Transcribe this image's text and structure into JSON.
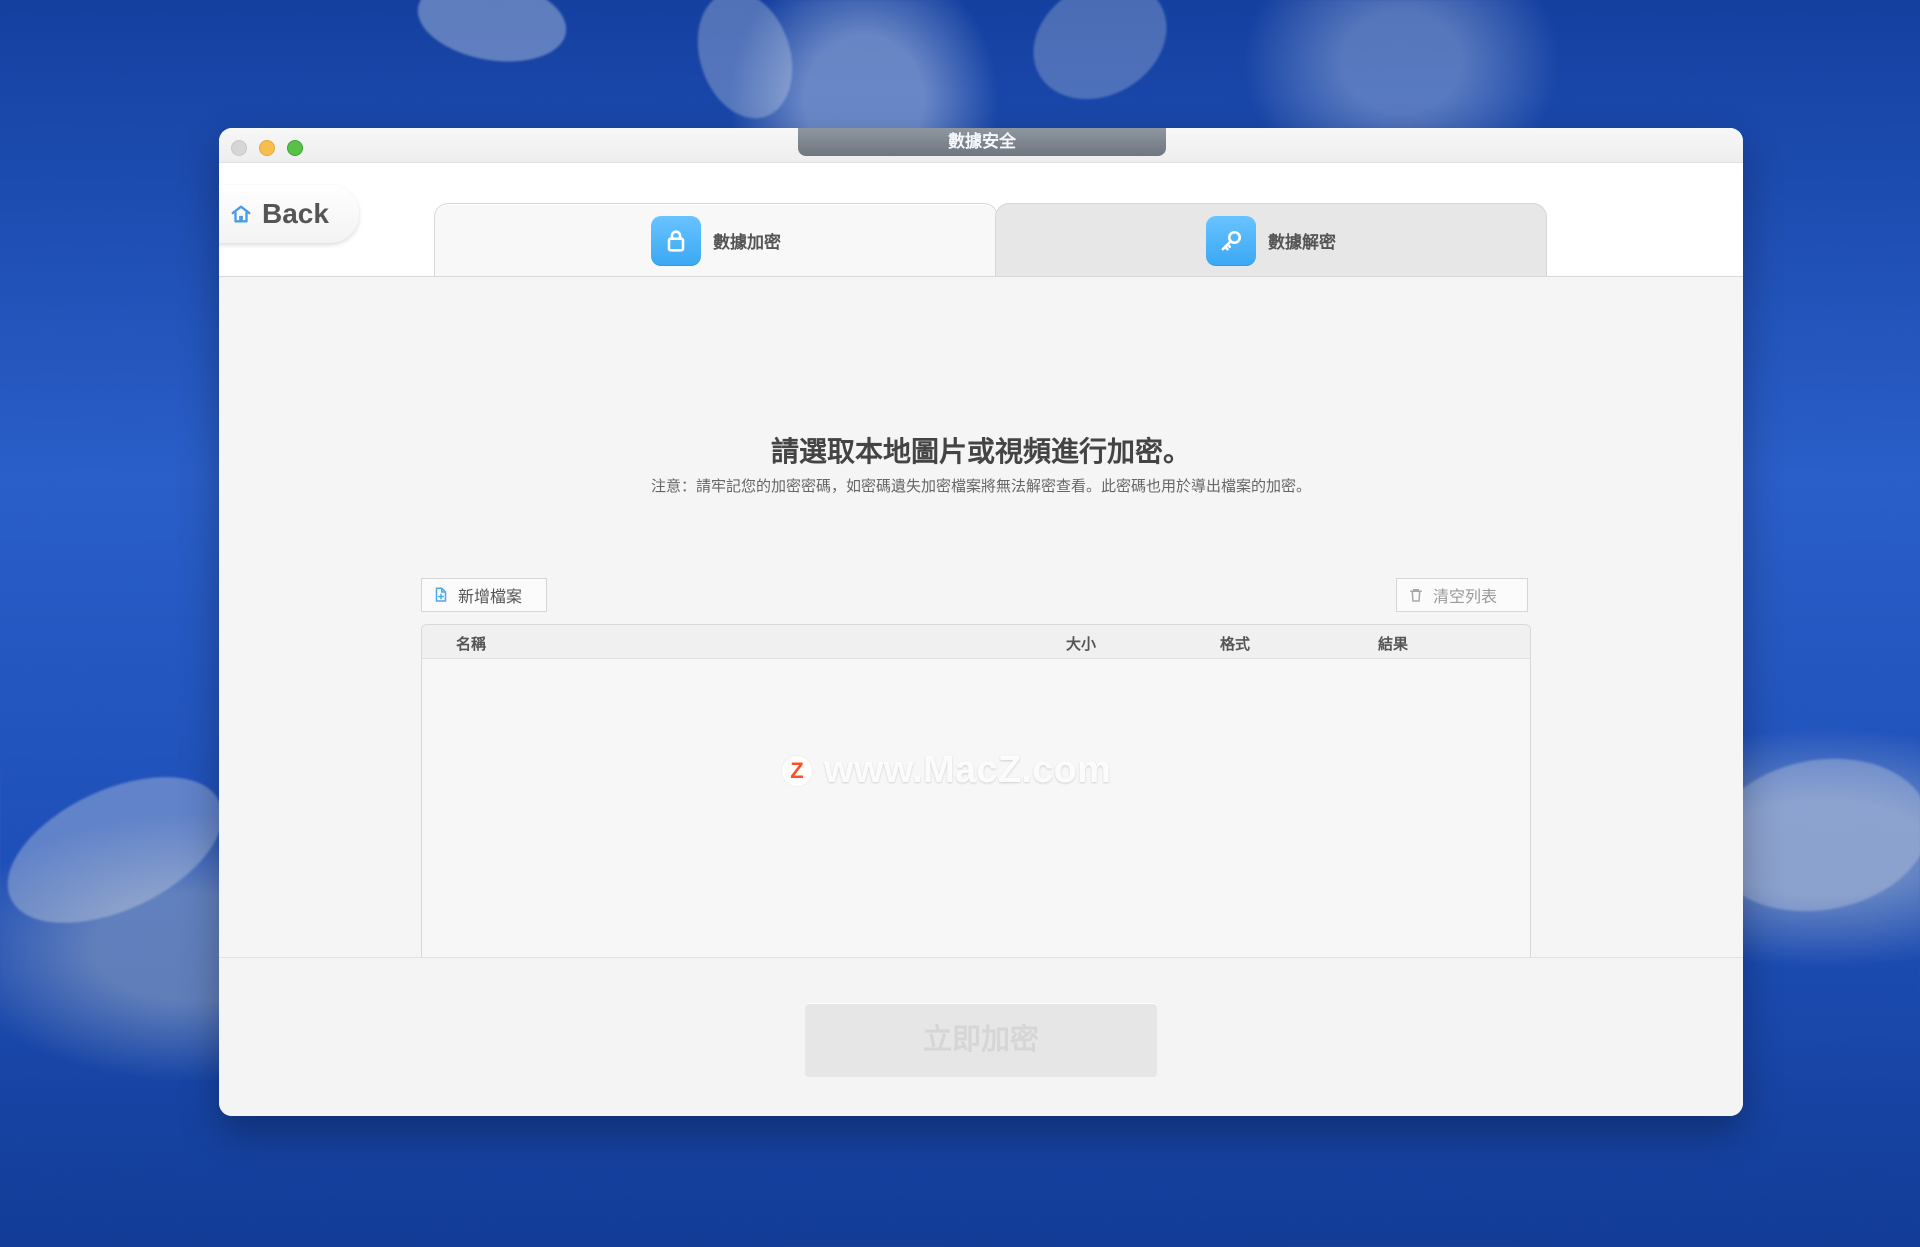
{
  "window": {
    "title": "數據安全"
  },
  "back": {
    "label": "Back"
  },
  "tabs": [
    {
      "label": "數據加密",
      "icon": "lock-icon"
    },
    {
      "label": "數據解密",
      "icon": "key-icon"
    }
  ],
  "main": {
    "title": "請選取本地圖片或視頻進行加密。",
    "note": "注意：請牢記您的加密密碼，如密碼遺失加密檔案將無法解密查看。此密碼也用於導出檔案的加密。"
  },
  "toolbar": {
    "add_file": "新增檔案",
    "clear_list": "清空列表"
  },
  "table": {
    "columns": [
      "名稱",
      "大小",
      "格式",
      "結果"
    ]
  },
  "watermark": {
    "logo": "Z",
    "text": "www.MacZ.com"
  },
  "footer": {
    "encrypt_button": "立即加密"
  },
  "colors": {
    "accent": "#45aef7",
    "window_bg": "#f5f5f5",
    "traffic_yellow": "#f5be4f",
    "traffic_green": "#58c247",
    "watermark_logo": "#ff4f24"
  }
}
